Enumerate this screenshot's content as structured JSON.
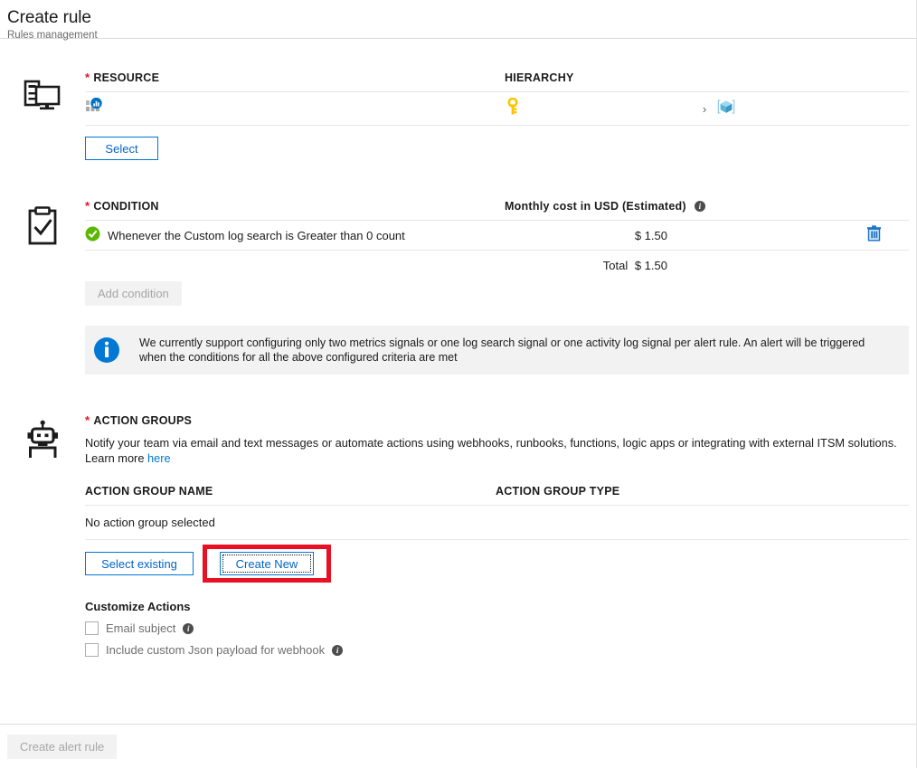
{
  "header": {
    "title": "Create rule",
    "subtitle": "Rules management"
  },
  "resource": {
    "section_label": "RESOURCE",
    "required_mark": "*",
    "hierarchy_label": "HIERARCHY",
    "resource_icon": "log-analytics-workspace-icon",
    "subscription_icon": "key-icon",
    "separator_icon": "chevron-right-icon",
    "resource_group_icon": "resource-group-cube-icon",
    "select_button": "Select",
    "gutter_icon": "server-monitor-icon"
  },
  "condition": {
    "section_label": "CONDITION",
    "required_mark": "*",
    "cost_header": "Monthly cost in USD (Estimated)",
    "cost_header_info_icon": "info-icon",
    "status_icon": "green-check-circle-icon",
    "rule_text": "Whenever the Custom log search is Greater than 0 count",
    "cost_value": "$ 1.50",
    "delete_icon": "trash-icon",
    "total_label": "Total",
    "total_value": "$ 1.50",
    "add_condition_button": "Add condition",
    "gutter_icon": "clipboard-check-icon",
    "info_banner": {
      "icon": "info-circle-icon",
      "text": "We currently support configuring only two metrics signals or one log search signal or one activity log signal per alert rule. An alert will be triggered when the conditions for all the above configured criteria are met"
    }
  },
  "action_groups": {
    "section_label": "ACTION GROUPS",
    "required_mark": "*",
    "description": "Notify your team via email and text messages or automate actions using webhooks, runbooks, functions, logic apps or integrating with external ITSM solutions. Learn more",
    "learn_more_link": "here",
    "column_name": "ACTION GROUP NAME",
    "column_type": "ACTION GROUP TYPE",
    "empty_text": "No action group selected",
    "select_existing_button": "Select existing",
    "create_new_button": "Create New",
    "gutter_icon": "robot-icon",
    "highlight_color": "#e81123"
  },
  "customize_actions": {
    "title": "Customize Actions",
    "items": [
      {
        "label": "Email subject",
        "checked": false,
        "info_icon": "info-icon"
      },
      {
        "label": "Include custom Json payload for webhook",
        "checked": false,
        "info_icon": "info-icon"
      }
    ]
  },
  "footer": {
    "submit_button": "Create alert rule",
    "submit_enabled": false
  },
  "colors": {
    "accent": "#0078d4",
    "link": "#0078d4",
    "required": "#e81123",
    "success": "#57a300",
    "highlight": "#e81123",
    "key_yellow": "#ffcc00"
  }
}
